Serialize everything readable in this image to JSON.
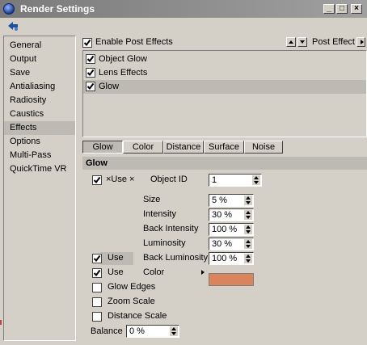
{
  "window": {
    "title": "Render Settings"
  },
  "sidebar": {
    "items": [
      {
        "label": "General"
      },
      {
        "label": "Output"
      },
      {
        "label": "Save"
      },
      {
        "label": "Antialiasing"
      },
      {
        "label": "Radiosity"
      },
      {
        "label": "Caustics"
      },
      {
        "label": "Effects"
      },
      {
        "label": "Options"
      },
      {
        "label": "Multi-Pass"
      },
      {
        "label": "QuickTime VR"
      }
    ],
    "selected": "Effects"
  },
  "effects": {
    "enable_label": "Enable Post Effects",
    "enable_checked": true,
    "post_effect_label": "Post Effect",
    "list": [
      {
        "label": "Object Glow",
        "checked": true
      },
      {
        "label": "Lens Effects",
        "checked": true
      },
      {
        "label": "Glow",
        "checked": true
      }
    ]
  },
  "tabs": [
    {
      "label": "Glow",
      "active": true
    },
    {
      "label": "Color"
    },
    {
      "label": "Distance"
    },
    {
      "label": "Surface"
    },
    {
      "label": "Noise"
    }
  ],
  "glow": {
    "header": "Glow",
    "use_object_id_label": "×Use ×",
    "object_id_label": "Object ID",
    "object_id_value": "1",
    "size_label": "Size",
    "size_value": "5 %",
    "intensity_label": "Intensity",
    "intensity_value": "30 %",
    "back_intensity_label": "Back Intensity",
    "back_intensity_value": "100 %",
    "luminosity_label": "Luminosity",
    "luminosity_value": "30 %",
    "use1_label": "Use",
    "back_luminosity_label": "Back Luminosity",
    "back_luminosity_value": "100 %",
    "use2_label": "Use",
    "color_label": "Color",
    "color_value": "#d9845a",
    "glow_edges_label": "Glow Edges",
    "zoom_scale_label": "Zoom Scale",
    "distance_scale_label": "Distance Scale",
    "balance_label": "Balance",
    "balance_value": "0 %"
  }
}
